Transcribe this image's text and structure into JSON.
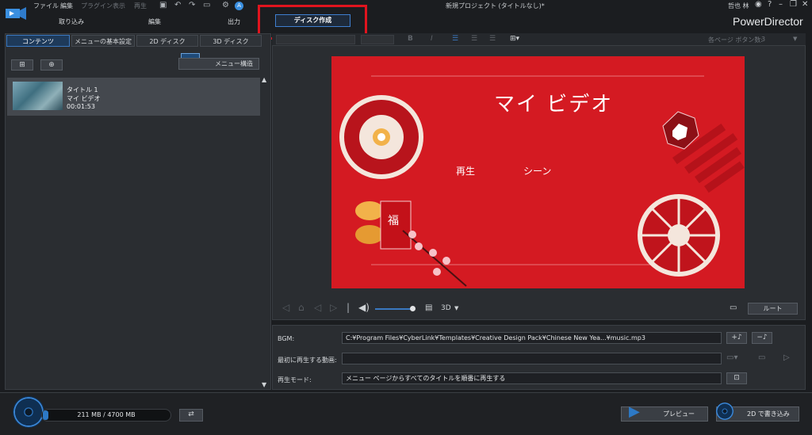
{
  "menubar": {
    "items": [
      "ファイル",
      "編集",
      "プラグイン",
      "表示",
      "再生"
    ],
    "title": "新規プロジェクト (タイトルなし)*",
    "user": "哲也 林",
    "help": "?",
    "brand": "PowerDirector"
  },
  "modes": {
    "capture": "取り込み",
    "edit": "編集",
    "produce": "出力",
    "disc": "ディスク作成"
  },
  "left": {
    "tabs": [
      "コンテンツ",
      "メニューの基本設定",
      "2D ディスク",
      "3D ディスク"
    ],
    "menu_struct": "メニュー構造",
    "title_item": {
      "name": "タイトル 1",
      "subtitle": "マイ ビデオ",
      "duration": "00:01:53"
    }
  },
  "format": {
    "per_page_label": "各ページ ボタン数:",
    "per_page_value": "3"
  },
  "preview": {
    "title": "マイ ビデオ",
    "play": "再生",
    "scene": "シーン",
    "badge_char": "福",
    "mode3d": "3D",
    "root": "ルート"
  },
  "settings": {
    "bgm_label": "BGM:",
    "bgm_value": "C:¥Program Files¥CyberLink¥Templates¥Creative Design Pack¥Chinese New Yea...¥music.mp3",
    "first_label": "最初に再生する動画:",
    "first_value": "",
    "mode_label": "再生モード:",
    "mode_value": "メニュー ページからすべてのタイトルを順番に再生する"
  },
  "bottom": {
    "capacity": "211 MB / 4700 MB",
    "capacity_fraction": 0.045,
    "preview": "プレビュー",
    "burn": "2D で書き込み"
  },
  "colors": {
    "accent": "#3a78c0",
    "stage_bg": "#d41a22",
    "highlight": "#e0141e"
  }
}
